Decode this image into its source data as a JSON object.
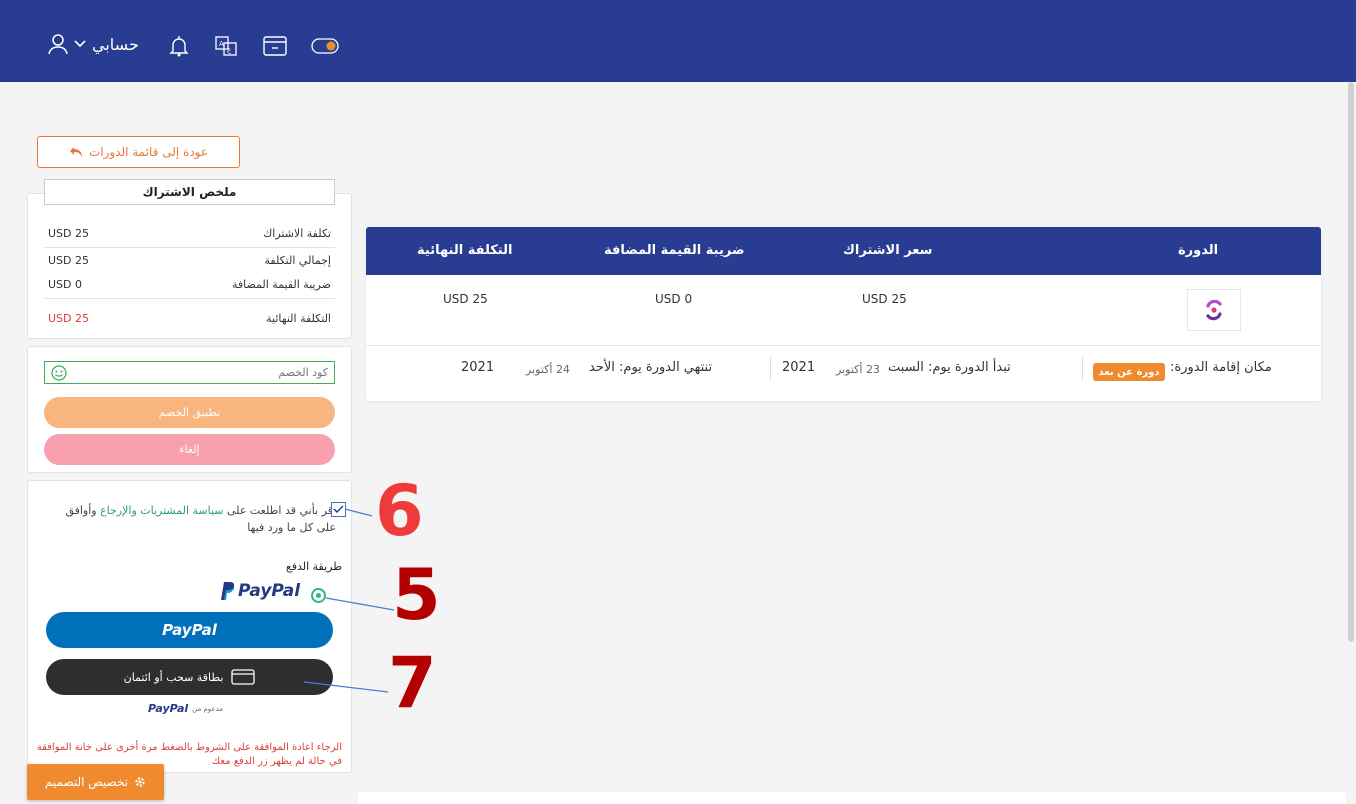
{
  "header": {
    "account_label": "حسابي"
  },
  "back_button": "عودة إلى قائمة الدورات",
  "summary": {
    "title": "ملخص الاشتراك",
    "rows": [
      {
        "label": "تكلفة الاشتراك",
        "value": "USD 25"
      },
      {
        "label": "إجمالي التكلفة",
        "value": "USD 25"
      },
      {
        "label": "ضريبة القيمة المضافة",
        "value": "USD 0"
      },
      {
        "label": "التكلفة النهائية",
        "value": "USD 25"
      }
    ]
  },
  "discount": {
    "placeholder": "كود الخصم",
    "apply": "تطبيق الخصم",
    "cancel": "إلغاء"
  },
  "terms": {
    "part1": "أقر بأني قد اطلعت على ",
    "link": "سياسة المشتريات والإرجاع",
    "part2": " وأوافق على كل ما ورد فيها"
  },
  "payment": {
    "label": "طريقة الدفع",
    "paypal_logo": "PayPal",
    "paypal_button": "PayPal",
    "card_button": "بطاقة سحب أو ائتمان",
    "powered_prefix": "مدعوم من",
    "powered_brand": "PayPal",
    "warning": "الرجاء اعادة الموافقة على الشروط بالضغط مرة أخرى على خانة الموافقة في حالة لم يظهر زر الدفع معك"
  },
  "customize": "تخصيص التصميم",
  "table": {
    "headers": [
      "الدورة",
      "سعر الاشتراك",
      "ضريبة القيمة المضافة",
      "التكلفة النهائية"
    ],
    "row": {
      "price": "USD 25",
      "vat": "USD 0",
      "final": "USD 25"
    }
  },
  "course_info": {
    "venue_label": "مكان إقامة الدورة:",
    "venue_badge": "دورة عن بعد",
    "start_label": "تبدأ الدورة يوم: السبت",
    "start_date": "23 أكتوبر",
    "start_year": "2021",
    "end_label": "تنتهي الدورة يوم: الأحد",
    "end_date": "24 أكتوبر",
    "end_year": "2021"
  },
  "annotations": [
    "6",
    "5",
    "7"
  ],
  "colors": {
    "navbar": "#283c91",
    "accent_orange": "#f08a2e",
    "apply_button": "#f8b57d",
    "cancel_button": "#f8a0ad",
    "paypal_blue": "#0070ba",
    "final_cost_red": "#d8403a",
    "callout_6": "#ef3a3a",
    "callout_5_7": "#b30000"
  }
}
